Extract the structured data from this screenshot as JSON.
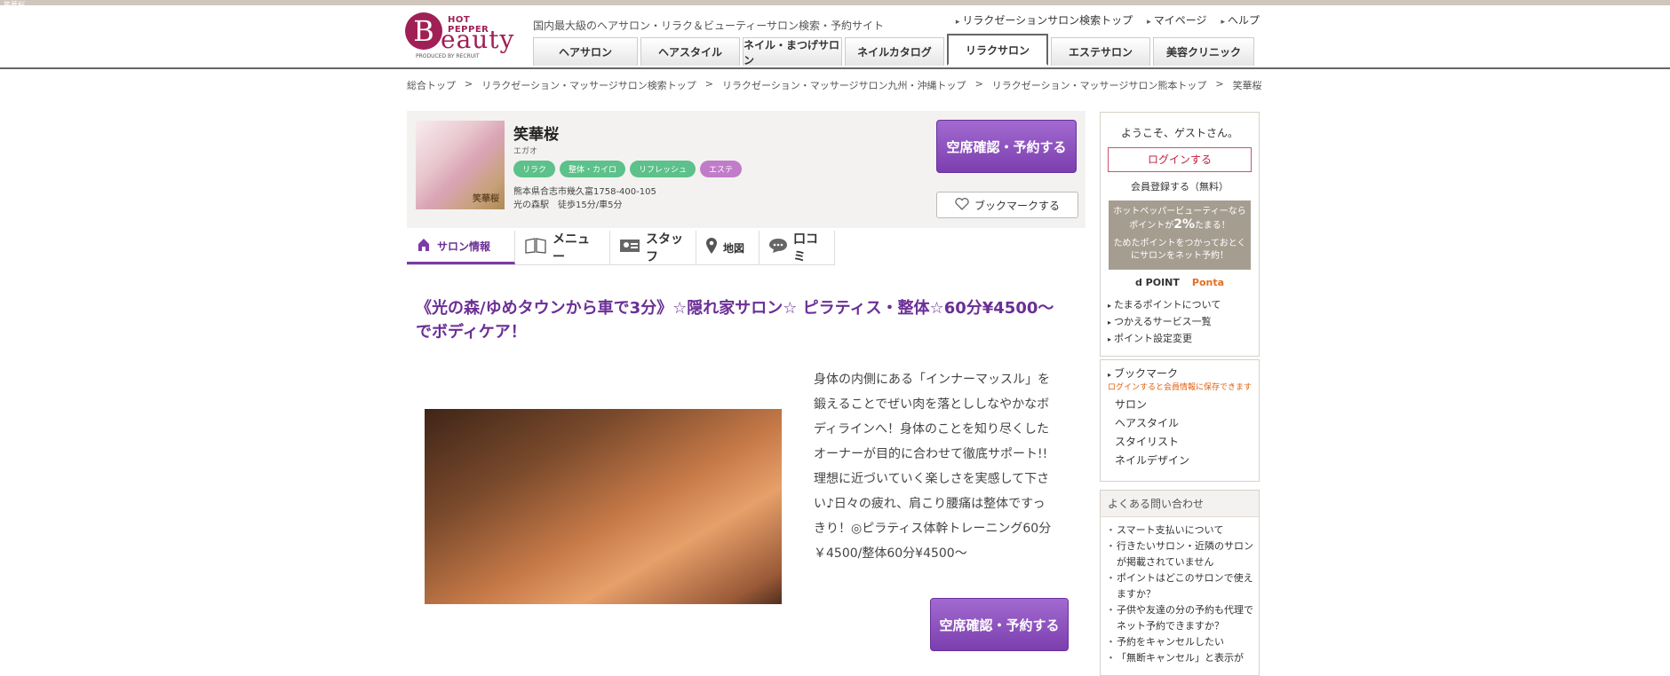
{
  "top_small": "笑華桜",
  "logo": {
    "hot_pepper": "HOT PEPPER",
    "b": "B",
    "eauty": "eauty",
    "produced": "PRODUCED BY RECRUIT"
  },
  "tagline": "国内最大級のヘアサロン・リラク＆ビューティーサロン検索・予約サイト",
  "top_links": [
    "リラクゼーションサロン検索トップ",
    "マイページ",
    "ヘルプ"
  ],
  "global_nav": [
    "ヘアサロン",
    "ヘアスタイル",
    "ネイル・まつげサロン",
    "ネイルカタログ",
    "リラクサロン",
    "エステサロン",
    "美容クリニック"
  ],
  "breadcrumbs": [
    "総合トップ",
    "リラクゼーション・マッサージサロン検索トップ",
    "リラクゼーション・マッサージサロン九州・沖縄トップ",
    "リラクゼーション・マッサージサロン熊本トップ",
    "笑華桜"
  ],
  "salon": {
    "thumb_text": "笑華桜",
    "name": "笑華桜",
    "kana": "エガオ",
    "tags": [
      "リラク",
      "整体・カイロ",
      "リフレッシュ",
      "エステ"
    ],
    "address": "熊本県合志市幾久富1758-400-105",
    "access": "光の森駅　徒歩15分/車5分",
    "reserve_label": "空席確認・予約する",
    "bookmark_label": "ブックマークする"
  },
  "subtabs": [
    "サロン情報",
    "メニュー",
    "スタッフ",
    "地図",
    "口コミ"
  ],
  "catch_copy": "《光の森/ゆめタウンから車で3分》☆隠れ家サロン☆ ピラティス・整体☆60分¥4500～でボディケア！",
  "description": "身体の内側にある「インナーマッスル」を鍛えることでぜい肉を落とししなやかなボディラインへ！身体のことを知り尽くしたオーナーが目的に合わせて徹底サポート!!理想に近づいていく楽しさを実感して下さい♪日々の疲れ、肩こり腰痛は整体ですっきり！◎ピラティス体幹トレーニング60分￥4500/整体60分¥4500～",
  "reserve_bottom": "空席確認・予約する",
  "sidebar": {
    "welcome": "ようこそ、ゲストさん。",
    "login": "ログインする",
    "signup": "会員登録する（無料）",
    "point_line1": "ホットペッパービューティーなら",
    "point_line2_pre": "ポイントが",
    "point_pct": "2%",
    "point_line2_post": "たまる！",
    "point_line3": "ためたポイントをつかっておとく",
    "point_line4": "にサロンをネット予約！",
    "dpoint": "d POINT",
    "ponta": "Ponta",
    "point_links": [
      "たまるポイントについて",
      "つかえるサービス一覧",
      "ポイント設定変更"
    ],
    "bookmark_title": "ブックマーク",
    "bookmark_note": "ログインすると会員情報に保存できます",
    "bookmark_links": [
      "サロン",
      "ヘアスタイル",
      "スタイリスト",
      "ネイルデザイン"
    ],
    "faq_title": "よくある問い合わせ",
    "faq_links": [
      "スマート支払いについて",
      "行きたいサロン・近隣のサロンが掲載されていません",
      "ポイントはどこのサロンで使えますか？",
      "子供や友達の分の予約も代理でネット予約できますか？",
      "予約をキャンセルしたい",
      "「無断キャンセル」と表示が"
    ]
  }
}
